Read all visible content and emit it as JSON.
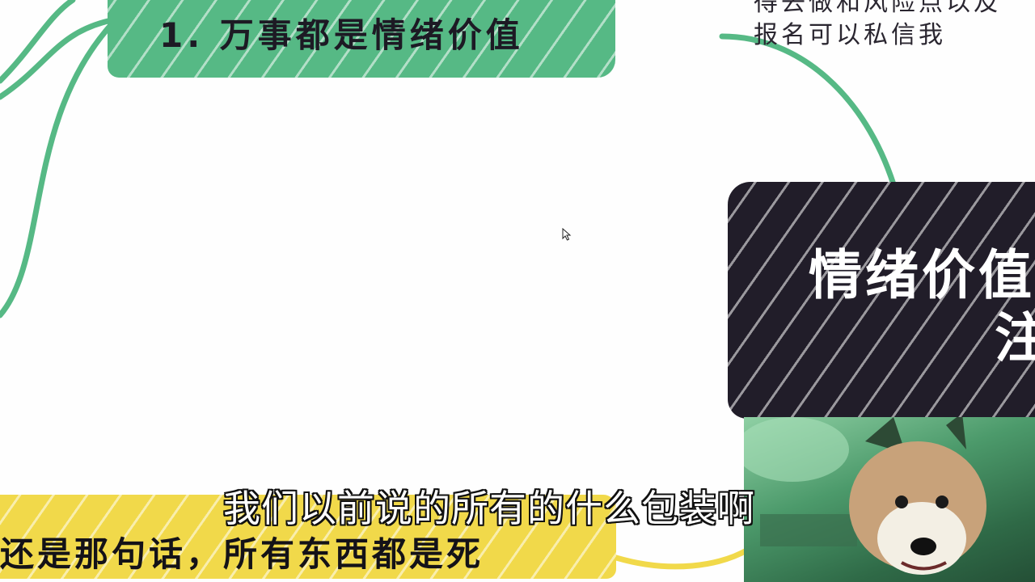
{
  "nodes": {
    "green": {
      "label": "1. 万事都是情绪价值"
    },
    "top_right": {
      "lines": [
        "得去做和风险点以及",
        "报名可以私信我"
      ]
    },
    "dark": {
      "title": "情绪价值",
      "sub": "注"
    },
    "yellow": {
      "label": "还是那句话，所有东西都是死"
    }
  },
  "subtitle": "我们以前说的所有的什么包装啊",
  "colors": {
    "green_node": "#56b985",
    "connector": "#56b985",
    "dark_node": "#211d29",
    "yellow_node": "#f1d94a",
    "background": "#fefefe"
  },
  "icons": [
    "mouse-cursor-icon"
  ]
}
